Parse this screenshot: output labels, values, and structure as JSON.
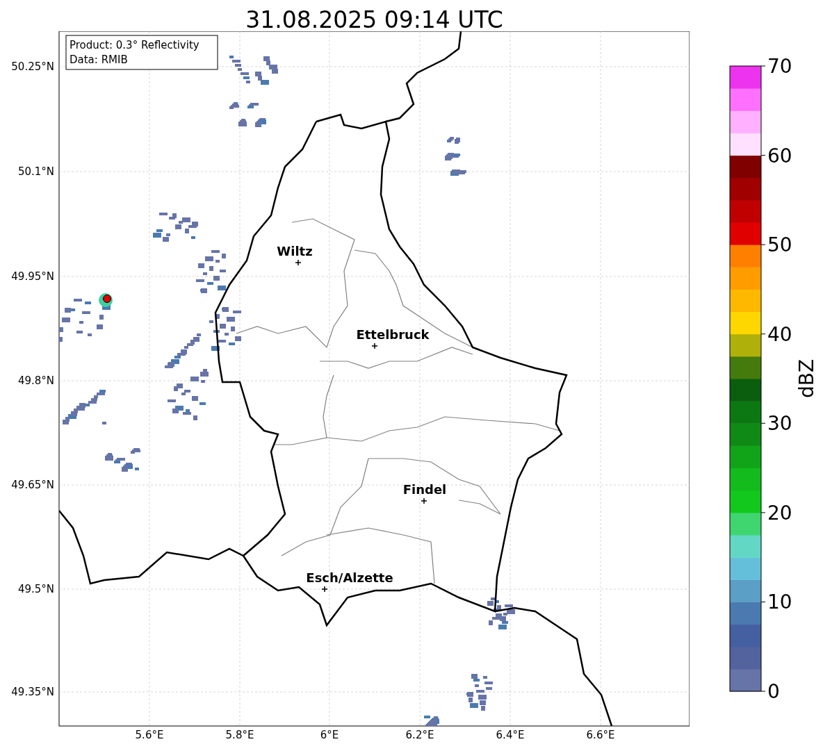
{
  "title": "31.08.2025 09:14 UTC",
  "legend": [
    "Product: 0.3° Reflectivity",
    "Data: RMIB"
  ],
  "map": {
    "lat_ticks": [
      "50.25°N",
      "50.1°N",
      "49.95°N",
      "49.8°N",
      "49.65°N",
      "49.5°N",
      "49.35°N"
    ],
    "lon_ticks": [
      "5.6°E",
      "5.8°E",
      "6°E",
      "6.2°E",
      "6.4°E",
      "6.6°E"
    ],
    "cities": [
      {
        "name": "Wiltz"
      },
      {
        "name": "Ettelbruck"
      },
      {
        "name": "Findel"
      },
      {
        "name": "Esch/Alzette"
      }
    ]
  },
  "colorbar": {
    "label": "dBZ",
    "ticks": [
      "70",
      "60",
      "50",
      "40",
      "30",
      "20",
      "10",
      "0"
    ],
    "segments": [
      {
        "color": "#6674a8"
      },
      {
        "color": "#52639e"
      },
      {
        "color": "#4560a0"
      },
      {
        "color": "#4a7ab0"
      },
      {
        "color": "#5b9ec6"
      },
      {
        "color": "#64c0da"
      },
      {
        "color": "#62d8c4"
      },
      {
        "color": "#3fd670"
      },
      {
        "color": "#13c81c"
      },
      {
        "color": "#13bb1c"
      },
      {
        "color": "#11a418"
      },
      {
        "color": "#0f8a14"
      },
      {
        "color": "#0c7812"
      },
      {
        "color": "#0a5e0e"
      },
      {
        "color": "#457a0c"
      },
      {
        "color": "#b0b00a"
      },
      {
        "color": "#ffd700"
      },
      {
        "color": "#ffb800"
      },
      {
        "color": "#ff9c00"
      },
      {
        "color": "#ff7f00"
      },
      {
        "color": "#e00000"
      },
      {
        "color": "#c00000"
      },
      {
        "color": "#a00000"
      },
      {
        "color": "#800000"
      },
      {
        "color": "#ffe0ff"
      },
      {
        "color": "#ffb0ff"
      },
      {
        "color": "#ff70ff"
      },
      {
        "color": "#ee33ee"
      }
    ]
  }
}
